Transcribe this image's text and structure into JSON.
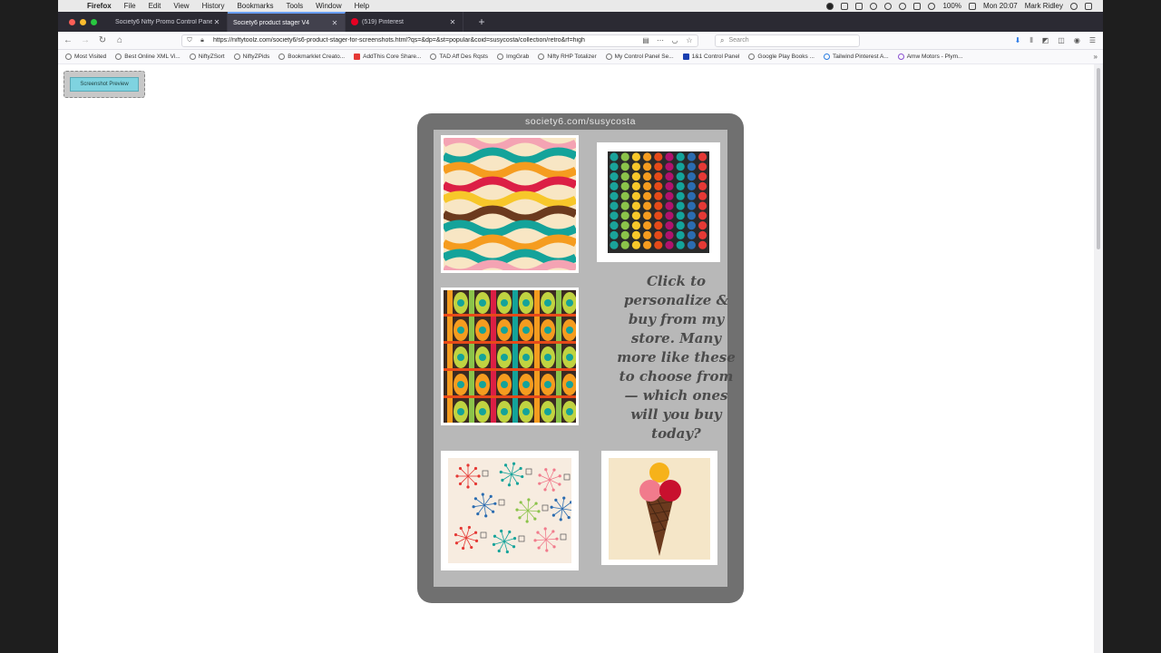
{
  "menubar": {
    "app": "Firefox",
    "items": [
      "File",
      "Edit",
      "View",
      "History",
      "Bookmarks",
      "Tools",
      "Window",
      "Help"
    ],
    "battery": "100%",
    "clock": "Mon 20:07",
    "user": "Mark Ridley"
  },
  "tabs": [
    {
      "label": "Society6 Nifty Promo Control Panel",
      "active": false
    },
    {
      "label": "Society6 product stager V4",
      "active": true
    },
    {
      "label": "(519) Pinterest",
      "active": false
    }
  ],
  "toolbar": {
    "url": "https://niftytoolz.com/society6/s6-product-stager-for-screenshots.html?qs=&dp=&st=popular&coid=susycosta/collection/retro&rf=high",
    "search_placeholder": "Search"
  },
  "bookmarks": [
    "Most Visited",
    "Best Online XML Vi...",
    "NiftyZSort",
    "NiftyZPids",
    "Bookmarklet Creato...",
    "AddThis Core Share...",
    "TAD Aff Des Rqsts",
    "ImgGrab",
    "Nifty RHP Totalizer",
    "My Control Panel Se...",
    "1&1 Control Panel",
    "Google Play Books ...",
    "Tailwind Pinterest A...",
    "Amw Motors - Plym..."
  ],
  "page": {
    "preview_button": "Screenshot Preview",
    "site_url": "society6.com/susycosta",
    "cta": "Click to personalize & buy from my store. Many more like these to choose from — which ones will you buy today?"
  },
  "colors": {
    "accent_tab": "#6aa0ff",
    "collage_frame": "#707070",
    "preview_button": "#7fd3e0"
  }
}
